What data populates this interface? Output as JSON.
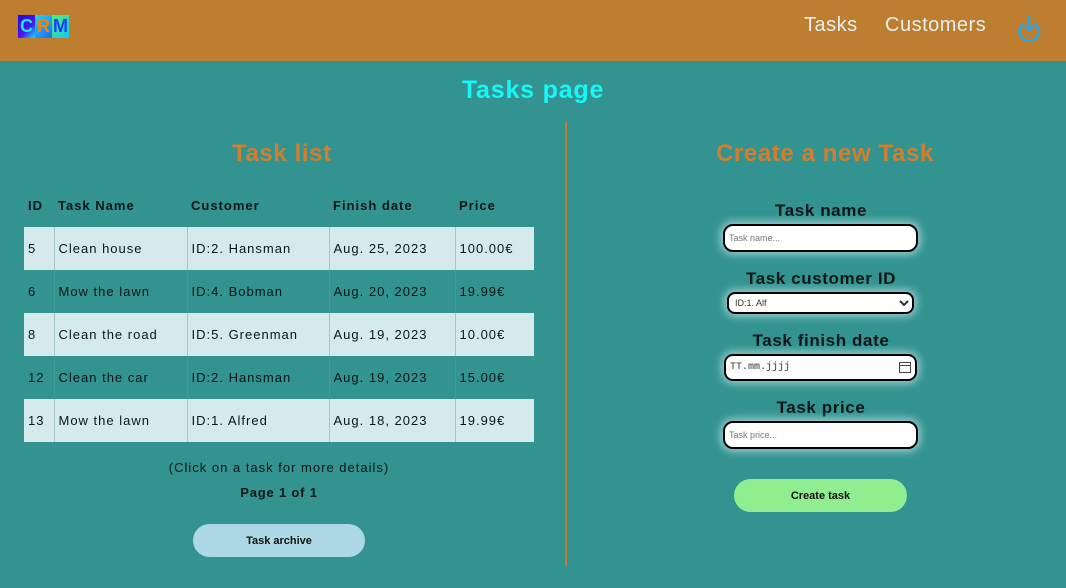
{
  "header": {
    "logo_text": "CRM",
    "nav": {
      "tasks": "Tasks",
      "customers": "Customers"
    },
    "logout_icon": "logout-power-icon"
  },
  "page_title": "Tasks page",
  "task_list": {
    "title": "Task list",
    "columns": [
      "ID",
      "Task Name",
      "Customer",
      "Finish date",
      "Price"
    ],
    "rows": [
      [
        "5",
        "Clean house",
        "ID:2. Hansman",
        "Aug. 25, 2023",
        "100.00€"
      ],
      [
        "6",
        "Mow the lawn",
        "ID:4. Bobman",
        "Aug. 20, 2023",
        "19.99€"
      ],
      [
        "8",
        "Clean the road",
        "ID:5. Greenman",
        "Aug. 19, 2023",
        "10.00€"
      ],
      [
        "12",
        "Clean the car",
        "ID:2. Hansman",
        "Aug. 19, 2023",
        "15.00€"
      ],
      [
        "13",
        "Mow the lawn",
        "ID:1. Alfred",
        "Aug. 18, 2023",
        "19.99€"
      ]
    ],
    "hint": "(Click on a task for more details)",
    "pagination": "Page 1 of 1",
    "archive_button": "Task archive"
  },
  "create_form": {
    "title": "Create a new Task",
    "name_label": "Task name",
    "name_placeholder": "Task name...",
    "customer_label": "Task customer ID",
    "customer_selected": "ID:1. Alf",
    "date_label": "Task finish date",
    "date_placeholder": "TT.mm.jjjj",
    "price_label": "Task price",
    "price_placeholder": "Task price...",
    "submit_button": "Create task"
  },
  "colors": {
    "header_bg": "#bd7e2f",
    "page_bg": "#339390",
    "title_cyan": "#16f8f8",
    "section_orange": "#d07f2e",
    "row_highlight": "#d5ebeb",
    "archive_button": "#add8e6",
    "create_button": "#90ee90"
  }
}
